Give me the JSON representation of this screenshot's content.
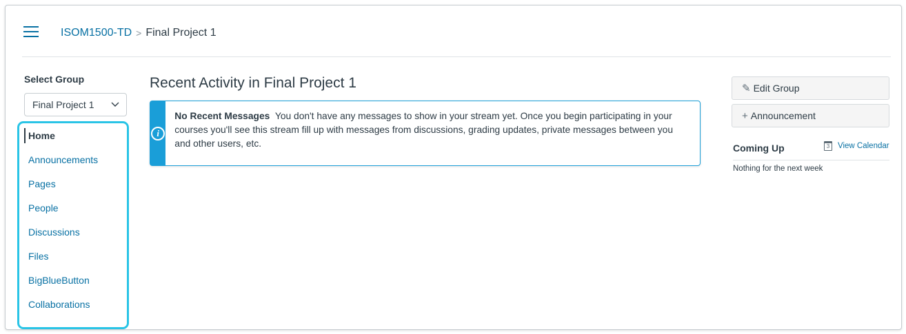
{
  "breadcrumb": {
    "course": "ISOM1500-TD",
    "separator": ">",
    "current": "Final Project 1"
  },
  "left_nav": {
    "select_group_label": "Select Group",
    "selected_group": "Final Project 1",
    "items": [
      {
        "label": "Home",
        "active": true
      },
      {
        "label": "Announcements"
      },
      {
        "label": "Pages"
      },
      {
        "label": "People"
      },
      {
        "label": "Discussions"
      },
      {
        "label": "Files"
      },
      {
        "label": "BigBlueButton"
      },
      {
        "label": "Collaborations"
      }
    ]
  },
  "main": {
    "title": "Recent Activity in Final Project 1",
    "alert": {
      "icon": "info-icon",
      "heading": "No Recent Messages",
      "body": "You don't have any messages to show in your stream yet. Once you begin participating in your courses you'll see this stream fill up with messages from discussions, grading updates, private messages between you and other users, etc."
    }
  },
  "sidebar": {
    "edit_group_label": "Edit Group",
    "announcement_label": "Announcement",
    "coming_up_label": "Coming Up",
    "view_calendar_label": "View Calendar",
    "calendar_icon_text": "3",
    "nothing_text": "Nothing for the next week"
  },
  "colors": {
    "link": "#0770a3",
    "highlight_border": "#29c4e6",
    "alert_accent": "#1a9ed8",
    "text": "#2d3b45"
  }
}
